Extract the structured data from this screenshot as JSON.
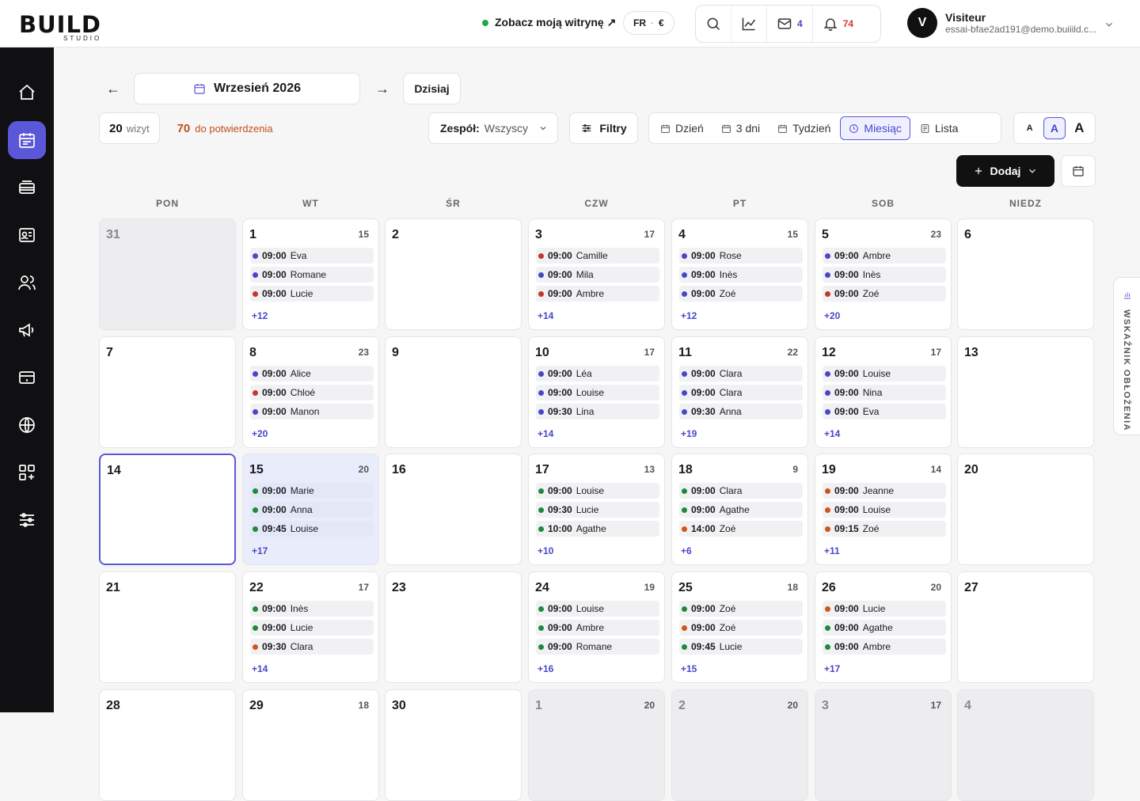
{
  "brand": {
    "logo_text": "BUILD",
    "logo_sub": "STUDIO"
  },
  "header": {
    "site_link": "Zobacz moją witrynę ↗",
    "lang": "FR",
    "currency": "€",
    "messages_count": "4",
    "notifications_count": "74",
    "user": {
      "initial": "V",
      "name": "Visiteur",
      "email": "essai-bfae2ad191@demo.buiiild.c..."
    }
  },
  "nav": {
    "month_label": "Wrzesień 2026",
    "today_label": "Dzisiaj",
    "prev": "←",
    "next": "→"
  },
  "stats": {
    "visits_count": "20",
    "visits_label": "wizyt",
    "pending_count": "70",
    "pending_label": "do potwierdzenia"
  },
  "toolbar": {
    "team_label": "Zespół:",
    "team_value": "Wszyscy",
    "filters_label": "Filtry",
    "views": [
      "Dzień",
      "3 dni",
      "Tydzień",
      "Miesiąc",
      "Lista"
    ],
    "active_view": "Miesiąc",
    "font_sizes": [
      "A",
      "A",
      "A"
    ],
    "add_label": "Dodaj"
  },
  "side_tab": "WSKAŹNIK OBŁOŻENIA",
  "colors": {
    "accent": "#5b57d9",
    "blue_dot": "#4a46c9",
    "red_dot": "#c0392b",
    "green_dot": "#1f8a3b",
    "orange_dot": "#d2541d"
  },
  "calendar": {
    "weekdays": [
      "PON",
      "WT",
      "ŚR",
      "CZW",
      "PT",
      "SOB",
      "NIEDZ"
    ],
    "weeks": [
      [
        {
          "day": "31",
          "other": true
        },
        {
          "day": "1",
          "count": "15",
          "events": [
            {
              "time": "09:00",
              "name": "Eva",
              "color": "blue"
            },
            {
              "time": "09:00",
              "name": "Romane",
              "color": "blue"
            },
            {
              "time": "09:00",
              "name": "Lucie",
              "color": "red"
            }
          ],
          "more": "+12"
        },
        {
          "day": "2"
        },
        {
          "day": "3",
          "count": "17",
          "events": [
            {
              "time": "09:00",
              "name": "Camille",
              "color": "red"
            },
            {
              "time": "09:00",
              "name": "Mila",
              "color": "blue"
            },
            {
              "time": "09:00",
              "name": "Ambre",
              "color": "red"
            }
          ],
          "more": "+14"
        },
        {
          "day": "4",
          "count": "15",
          "events": [
            {
              "time": "09:00",
              "name": "Rose",
              "color": "blue"
            },
            {
              "time": "09:00",
              "name": "Inès",
              "color": "blue"
            },
            {
              "time": "09:00",
              "name": "Zoé",
              "color": "blue"
            }
          ],
          "more": "+12"
        },
        {
          "day": "5",
          "count": "23",
          "events": [
            {
              "time": "09:00",
              "name": "Ambre",
              "color": "blue"
            },
            {
              "time": "09:00",
              "name": "Inès",
              "color": "blue"
            },
            {
              "time": "09:00",
              "name": "Zoé",
              "color": "red"
            }
          ],
          "more": "+20"
        },
        {
          "day": "6"
        }
      ],
      [
        {
          "day": "7"
        },
        {
          "day": "8",
          "count": "23",
          "events": [
            {
              "time": "09:00",
              "name": "Alice",
              "color": "blue"
            },
            {
              "time": "09:00",
              "name": "Chloé",
              "color": "red"
            },
            {
              "time": "09:00",
              "name": "Manon",
              "color": "blue"
            }
          ],
          "more": "+20"
        },
        {
          "day": "9"
        },
        {
          "day": "10",
          "count": "17",
          "events": [
            {
              "time": "09:00",
              "name": "Léa",
              "color": "blue"
            },
            {
              "time": "09:00",
              "name": "Louise",
              "color": "blue"
            },
            {
              "time": "09:30",
              "name": "Lina",
              "color": "blue"
            }
          ],
          "more": "+14"
        },
        {
          "day": "11",
          "count": "22",
          "events": [
            {
              "time": "09:00",
              "name": "Clara",
              "color": "blue"
            },
            {
              "time": "09:00",
              "name": "Clara",
              "color": "blue"
            },
            {
              "time": "09:30",
              "name": "Anna",
              "color": "blue"
            }
          ],
          "more": "+19"
        },
        {
          "day": "12",
          "count": "17",
          "events": [
            {
              "time": "09:00",
              "name": "Louise",
              "color": "blue"
            },
            {
              "time": "09:00",
              "name": "Nina",
              "color": "blue"
            },
            {
              "time": "09:00",
              "name": "Eva",
              "color": "blue"
            }
          ],
          "more": "+14"
        },
        {
          "day": "13"
        }
      ],
      [
        {
          "day": "14",
          "today": true
        },
        {
          "day": "15",
          "count": "20",
          "hl": true,
          "events": [
            {
              "time": "09:00",
              "name": "Marie",
              "color": "green"
            },
            {
              "time": "09:00",
              "name": "Anna",
              "color": "green"
            },
            {
              "time": "09:45",
              "name": "Louise",
              "color": "green"
            }
          ],
          "more": "+17"
        },
        {
          "day": "16"
        },
        {
          "day": "17",
          "count": "13",
          "events": [
            {
              "time": "09:00",
              "name": "Louise",
              "color": "green"
            },
            {
              "time": "09:30",
              "name": "Lucie",
              "color": "green"
            },
            {
              "time": "10:00",
              "name": "Agathe",
              "color": "green"
            }
          ],
          "more": "+10"
        },
        {
          "day": "18",
          "count": "9",
          "events": [
            {
              "time": "09:00",
              "name": "Clara",
              "color": "green"
            },
            {
              "time": "09:00",
              "name": "Agathe",
              "color": "green"
            },
            {
              "time": "14:00",
              "name": "Zoé",
              "color": "orange"
            }
          ],
          "more": "+6"
        },
        {
          "day": "19",
          "count": "14",
          "events": [
            {
              "time": "09:00",
              "name": "Jeanne",
              "color": "orange"
            },
            {
              "time": "09:00",
              "name": "Louise",
              "color": "orange"
            },
            {
              "time": "09:15",
              "name": "Zoé",
              "color": "orange"
            }
          ],
          "more": "+11"
        },
        {
          "day": "20"
        }
      ],
      [
        {
          "day": "21"
        },
        {
          "day": "22",
          "count": "17",
          "events": [
            {
              "time": "09:00",
              "name": "Inès",
              "color": "green"
            },
            {
              "time": "09:00",
              "name": "Lucie",
              "color": "green"
            },
            {
              "time": "09:30",
              "name": "Clara",
              "color": "orange"
            }
          ],
          "more": "+14"
        },
        {
          "day": "23"
        },
        {
          "day": "24",
          "count": "19",
          "events": [
            {
              "time": "09:00",
              "name": "Louise",
              "color": "green"
            },
            {
              "time": "09:00",
              "name": "Ambre",
              "color": "green"
            },
            {
              "time": "09:00",
              "name": "Romane",
              "color": "green"
            }
          ],
          "more": "+16"
        },
        {
          "day": "25",
          "count": "18",
          "events": [
            {
              "time": "09:00",
              "name": "Zoé",
              "color": "green"
            },
            {
              "time": "09:00",
              "name": "Zoé",
              "color": "orange"
            },
            {
              "time": "09:45",
              "name": "Lucie",
              "color": "green"
            }
          ],
          "more": "+15"
        },
        {
          "day": "26",
          "count": "20",
          "events": [
            {
              "time": "09:00",
              "name": "Lucie",
              "color": "orange"
            },
            {
              "time": "09:00",
              "name": "Agathe",
              "color": "green"
            },
            {
              "time": "09:00",
              "name": "Ambre",
              "color": "green"
            }
          ],
          "more": "+17"
        },
        {
          "day": "27"
        }
      ],
      [
        {
          "day": "28"
        },
        {
          "day": "29",
          "count": "18"
        },
        {
          "day": "30"
        },
        {
          "day": "1",
          "count": "20",
          "other": true
        },
        {
          "day": "2",
          "count": "20",
          "other": true
        },
        {
          "day": "3",
          "count": "17",
          "other": true
        },
        {
          "day": "4",
          "other": true
        }
      ]
    ]
  }
}
